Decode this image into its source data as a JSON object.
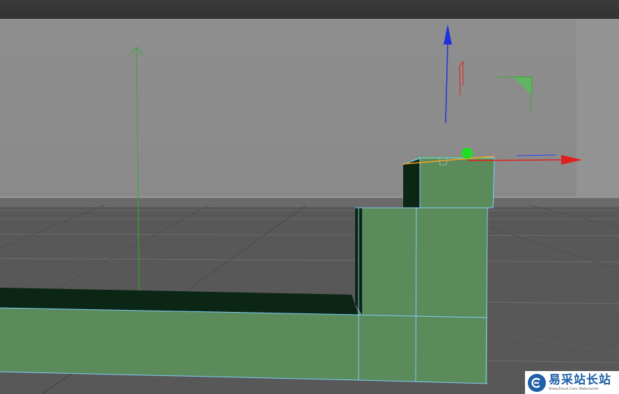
{
  "app": {
    "view": "perspective-viewport"
  },
  "watermark": {
    "title": "易采站长站",
    "subtitle": "Www.Easck.Com Webmaster",
    "brand_color": "#1f5fa8"
  },
  "colors": {
    "viewport_bg": "#8a8a8a",
    "floor": "#5a5a5a",
    "model_face": "#5b8a5b",
    "model_dark": "#0b2614",
    "edge": "#7fd0ff",
    "axis_x": "#e02020",
    "axis_y": "#20c020",
    "axis_z": "#2030e0"
  },
  "icons": {
    "move_gizmo": "move-gizmo-icon",
    "pivot": "pivot-handle-icon"
  }
}
